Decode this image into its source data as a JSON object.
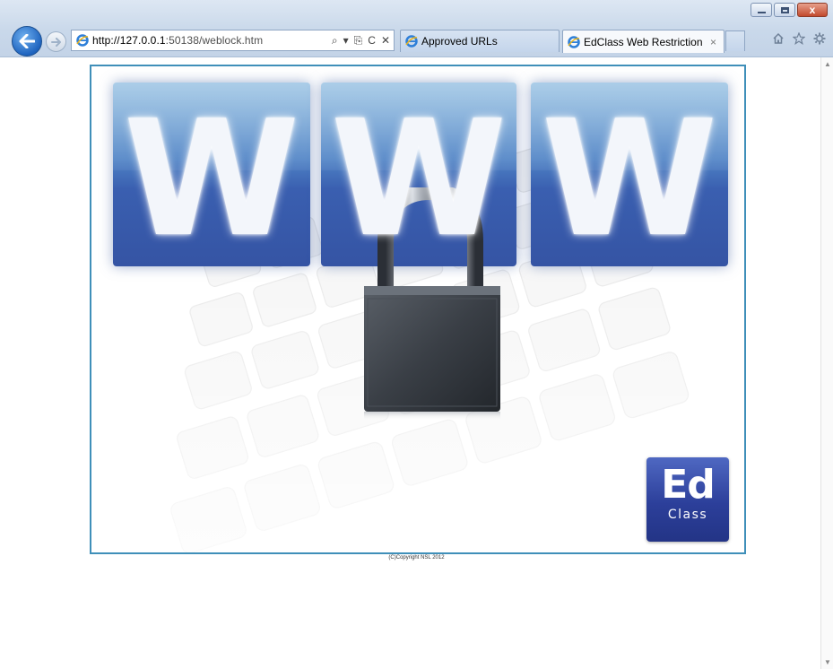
{
  "browser": {
    "address_url_host": "http://127.0.0.1",
    "address_url_rest": ":50138/weblock.htm",
    "tabs": [
      {
        "label": "Approved URLs",
        "active": false
      },
      {
        "label": "EdClass Web Restriction",
        "active": true,
        "close": "×"
      }
    ],
    "window_buttons": {
      "close": "x"
    },
    "address_tools": {
      "search": "⌕",
      "dropdown": "▾",
      "compat": "⎘",
      "refresh": "C",
      "stop": "✕"
    }
  },
  "banner": {
    "letters": [
      "W",
      "W",
      "W"
    ],
    "logo_line1": "Ed",
    "logo_line2": "Class"
  },
  "footer": {
    "copyright": "(C)Copyright NSL 2012"
  },
  "colors": {
    "tile_blue": "#3a5fb0",
    "logo_blue": "#2c3f9a",
    "frame_border": "#3f8fb9",
    "back_button": "#1f64bf"
  }
}
